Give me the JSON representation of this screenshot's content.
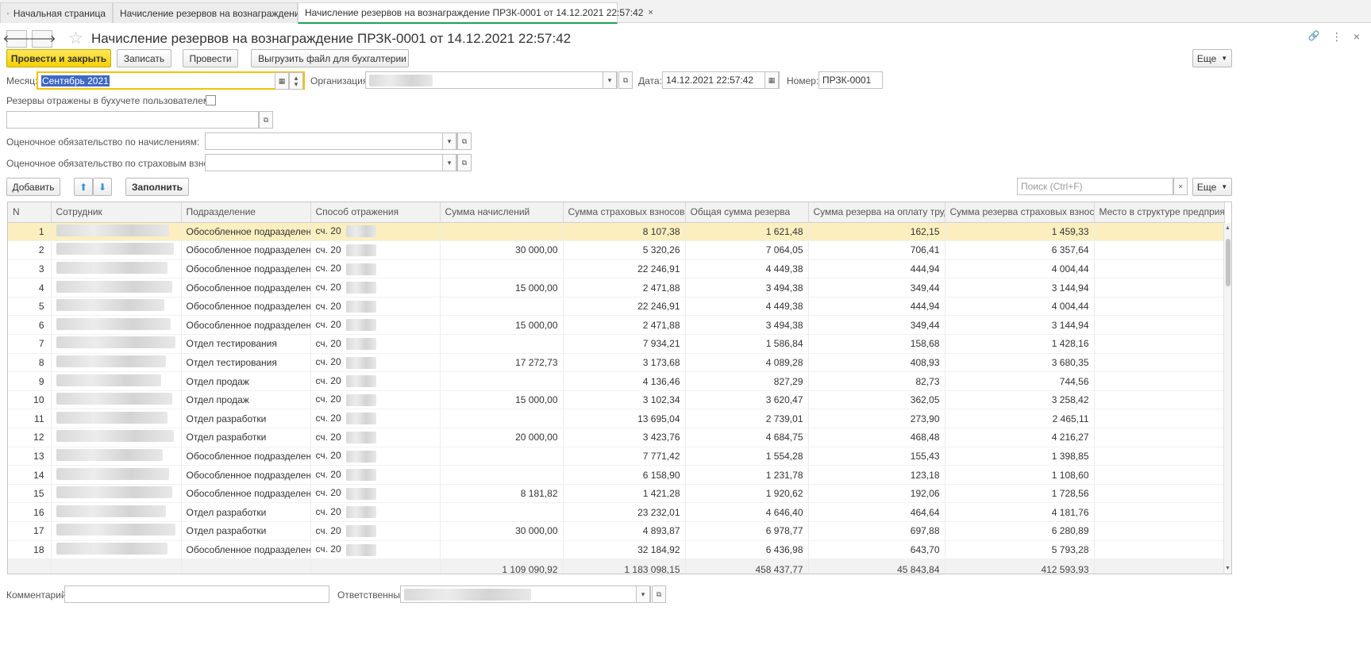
{
  "tabs": [
    {
      "label": "Начальная страница"
    },
    {
      "label": "Начисление резервов на вознаграждение",
      "close": "×"
    },
    {
      "label": "Начисление резервов на вознаграждение ПРЗК-0001 от 14.12.2021 22:57:42",
      "close": "×"
    }
  ],
  "header": {
    "back": "🡐",
    "forward": "🡒",
    "title": "Начисление резервов на вознаграждение ПРЗК-0001 от 14.12.2021 22:57:42",
    "icons": {
      "link": "🔗",
      "more": "⋮",
      "close": "×"
    }
  },
  "toolbar": {
    "post_close": "Провести и закрыть",
    "save": "Записать",
    "post": "Провести",
    "export": "Выгрузить файл для бухгалтерии",
    "more": "Еще"
  },
  "form": {
    "month_label": "Месяц:",
    "month_value": "Сентябрь 2021",
    "org_label": "Организация:",
    "date_label": "Дата:",
    "date_value": "14.12.2021 22:57:42",
    "number_label": "Номер:",
    "number_value": "ПРЗК-0001",
    "reserves_label": "Резервы отражены в бухучете пользователем:",
    "accrual_liability_label": "Оценочное обязательство по начислениям:",
    "insurance_liability_label": "Оценочное обязательство по страховым взносам:"
  },
  "table_toolbar": {
    "add": "Добавить",
    "up": "⬆",
    "down": "⬇",
    "fill": "Заполнить",
    "search_placeholder": "Поиск (Ctrl+F)",
    "clear": "×",
    "more": "Еще"
  },
  "columns": [
    "N",
    "Сотрудник",
    "Подразделение",
    "Способ отражения",
    "Сумма начислений",
    "Сумма страховых взносов",
    "Общая сумма резерва",
    "Сумма резерва на оплату труда",
    "Сумма резерва страховых взносов",
    "Место в структуре предприя..."
  ],
  "rows": [
    [
      "1",
      "Обособленное подразделен...",
      "сч. 20",
      "",
      "8 107,38",
      "1 621,48",
      "162,15",
      "1 459,33"
    ],
    [
      "2",
      "Обособленное подразделен...",
      "сч. 20",
      "30 000,00",
      "5 320,26",
      "7 064,05",
      "706,41",
      "6 357,64"
    ],
    [
      "3",
      "Обособленное подразделен...",
      "сч. 20",
      "",
      "22 246,91",
      "4 449,38",
      "444,94",
      "4 004,44"
    ],
    [
      "4",
      "Обособленное подразделен...",
      "сч. 20",
      "15 000,00",
      "2 471,88",
      "3 494,38",
      "349,44",
      "3 144,94"
    ],
    [
      "5",
      "Обособленное подразделен...",
      "сч. 20",
      "",
      "22 246,91",
      "4 449,38",
      "444,94",
      "4 004,44"
    ],
    [
      "6",
      "Обособленное подразделен...",
      "сч. 20",
      "15 000,00",
      "2 471,88",
      "3 494,38",
      "349,44",
      "3 144,94"
    ],
    [
      "7",
      "Отдел тестирования",
      "сч. 20",
      "",
      "7 934,21",
      "1 586,84",
      "158,68",
      "1 428,16"
    ],
    [
      "8",
      "Отдел тестирования",
      "сч. 20",
      "17 272,73",
      "3 173,68",
      "4 089,28",
      "408,93",
      "3 680,35"
    ],
    [
      "9",
      "Отдел продаж",
      "сч. 20",
      "",
      "4 136,46",
      "827,29",
      "82,73",
      "744,56"
    ],
    [
      "10",
      "Отдел продаж",
      "сч. 20",
      "15 000,00",
      "3 102,34",
      "3 620,47",
      "362,05",
      "3 258,42"
    ],
    [
      "11",
      "Отдел разработки",
      "сч. 20",
      "",
      "13 695,04",
      "2 739,01",
      "273,90",
      "2 465,11"
    ],
    [
      "12",
      "Отдел разработки",
      "сч. 20",
      "20 000,00",
      "3 423,76",
      "4 684,75",
      "468,48",
      "4 216,27"
    ],
    [
      "13",
      "Обособленное подразделен...",
      "сч. 20",
      "",
      "7 771,42",
      "1 554,28",
      "155,43",
      "1 398,85"
    ],
    [
      "14",
      "Обособленное подразделен...",
      "сч. 20",
      "",
      "6 158,90",
      "1 231,78",
      "123,18",
      "1 108,60"
    ],
    [
      "15",
      "Обособленное подразделен...",
      "сч. 20",
      "8 181,82",
      "1 421,28",
      "1 920,62",
      "192,06",
      "1 728,56"
    ],
    [
      "16",
      "Отдел разработки",
      "сч. 20",
      "",
      "23 232,01",
      "4 646,40",
      "464,64",
      "4 181,76"
    ],
    [
      "17",
      "Отдел разработки",
      "сч. 20",
      "30 000,00",
      "4 893,87",
      "6 978,77",
      "697,88",
      "6 280,89"
    ],
    [
      "18",
      "Обособленное подразделен...",
      "сч. 20",
      "",
      "32 184,92",
      "6 436,98",
      "643,70",
      "5 793,28"
    ]
  ],
  "totals": [
    "1 109 090,92",
    "1 183 098,15",
    "458 437,77",
    "45 843,84",
    "412 593,93"
  ],
  "footer": {
    "comment_label": "Комментарий:",
    "responsible_label": "Ответственный:"
  },
  "colors": {
    "accent": "#f5d000",
    "selected_row": "#fbefc0",
    "active_tab": "#1e9e5a"
  }
}
